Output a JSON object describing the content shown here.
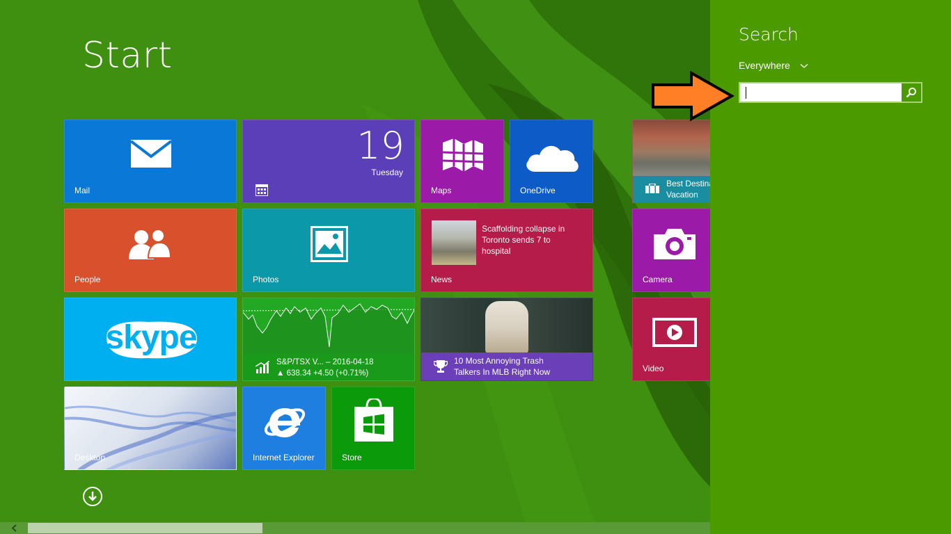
{
  "start": {
    "title": "Start"
  },
  "tiles": {
    "mail": {
      "label": "Mail"
    },
    "calendar": {
      "day": "19",
      "weekday": "Tuesday"
    },
    "maps": {
      "label": "Maps"
    },
    "onedrive": {
      "label": "OneDrive"
    },
    "travel": {
      "line1": "Best Destina",
      "line2": "Vacation"
    },
    "people": {
      "label": "People"
    },
    "photos": {
      "label": "Photos"
    },
    "news": {
      "headline": "Scaffolding collapse in Toronto sends 7 to hospital",
      "label": "News"
    },
    "camera": {
      "label": "Camera"
    },
    "skype": {
      "logo_text": "skype"
    },
    "finance": {
      "line1": "S&P/TSX V... – 2016-04-18",
      "line2": "▲ 638.34 +4.50 (+0.71%)"
    },
    "sports": {
      "line1": "10 Most Annoying Trash",
      "line2": "Talkers In MLB Right Now"
    },
    "video": {
      "label": "Video"
    },
    "desktop": {
      "label": "Desktop"
    },
    "ie": {
      "label": "Internet Explorer"
    },
    "store": {
      "label": "Store"
    }
  },
  "search_pane": {
    "title": "Search",
    "scope": "Everywhere",
    "input_value": "",
    "placeholder": ""
  },
  "colors": {
    "start_bg": "#3f8f10",
    "charm_bg": "#4a9a00",
    "mail": "#0a78d7",
    "calendar": "#5a3fb8",
    "maps": "#9b1aa8",
    "onedrive": "#0d5bc6",
    "people": "#d9512c",
    "photos": "#0b98a8",
    "news": "#b51c4a",
    "camera": "#9b1aa8",
    "skype": "#00aff0",
    "finance": "#22a822",
    "video": "#b51c4a",
    "ie": "#1e7fe0",
    "store": "#0a9a0a",
    "annotation_arrow": "#ff7f27"
  },
  "icons": [
    "mail-icon",
    "calendar-icon",
    "maps-icon",
    "onedrive-icon",
    "people-icon",
    "photos-icon",
    "camera-icon",
    "skype-logo",
    "finance-chart-icon",
    "trophy-icon",
    "video-icon",
    "ie-icon",
    "store-icon",
    "travel-icon",
    "down-arrow-icon",
    "search-icon",
    "chevron-down-icon"
  ]
}
